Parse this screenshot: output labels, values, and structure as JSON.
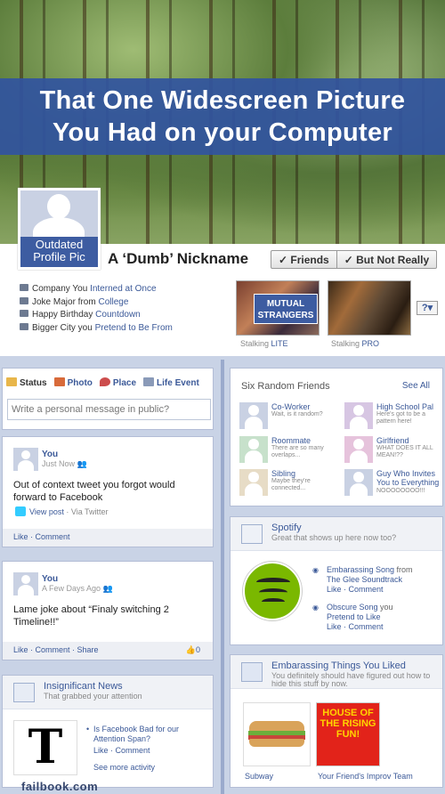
{
  "cover": {
    "banner_line1": "That One Widescreen Picture",
    "banner_line2": "You Had on your Computer"
  },
  "profile": {
    "pic_caption_1": "Outdated",
    "pic_caption_2": "Profile Pic",
    "nickname": "A ‘Dumb’ Nickname",
    "friends_btn": "✓ Friends",
    "but_btn": "✓ But Not Really"
  },
  "info": [
    {
      "pre": "Company You ",
      "link": "Interned at Once",
      "post": ""
    },
    {
      "pre": "Joke Major from ",
      "link": "College",
      "post": ""
    },
    {
      "pre": "Happy Birthday ",
      "link": "Countdown",
      "post": ""
    },
    {
      "pre": "Bigger City you ",
      "link": "Pretend to Be From",
      "post": ""
    }
  ],
  "thumbs": {
    "mutual_1": "MUTUAL",
    "mutual_2": "STRANGERS",
    "label1_a": "Stalking ",
    "label1_b": "LITE",
    "label2_a": "Stalking ",
    "label2_b": "PRO",
    "more": "?▾"
  },
  "composer": {
    "tabs": [
      "Status",
      "Photo",
      "Place",
      "Life Event"
    ],
    "placeholder": "Write a personal message in public?"
  },
  "post1": {
    "name": "You",
    "time": "Just Now",
    "body": "Out of context tweet you forgot would forward to Facebook",
    "view": "View post",
    "via": " · Via Twitter",
    "actions": "Like · Comment"
  },
  "post2": {
    "name": "You",
    "time": "A Few Days Ago",
    "body": "Lame joke about “Finaly switching 2 Timeline!!”",
    "actions": "Like · Comment · Share",
    "likes": "0"
  },
  "news": {
    "title": "Insignificant News",
    "subtitle": "That grabbed your attention",
    "article": "Is Facebook Bad for our Attention Span?",
    "actions": "Like · Comment",
    "more": "See more activity"
  },
  "friends": {
    "title": "Six Random Friends",
    "see_all": "See All",
    "items": [
      {
        "name": "Co-Worker",
        "desc": "Wait, is it random?"
      },
      {
        "name": "High School Pal",
        "desc": "Here's got to be a pattern here!"
      },
      {
        "name": "Roommate",
        "desc": "There are so many overlaps..."
      },
      {
        "name": "Girlfriend",
        "desc": "WHAT DOES IT ALL MEAN!??"
      },
      {
        "name": "Sibling",
        "desc": "Maybe they're connected..."
      },
      {
        "name": "Guy Who Invites You to Everything",
        "desc": "NOOOOOOOO!!!"
      }
    ]
  },
  "spotify": {
    "title": "Spotify",
    "subtitle": "Great that shows up here now too?",
    "song1_a": "Embarassing Song",
    "song1_b": " from",
    "song1_c": "The Glee Soundtrack",
    "song2_a": "Obscure Song",
    "song2_b": " you",
    "song2_c": "Pretend to Like",
    "actions": "Like · Comment"
  },
  "likes": {
    "title": "Embarassing Things You Liked",
    "subtitle": "You definitely should have figured out how to hide this stuff by now.",
    "item1": "Subway",
    "item2": "Your Friend's Improv Team",
    "poster": "HOUSE OF THE RISING FUN!"
  },
  "footer": "failbook.com"
}
